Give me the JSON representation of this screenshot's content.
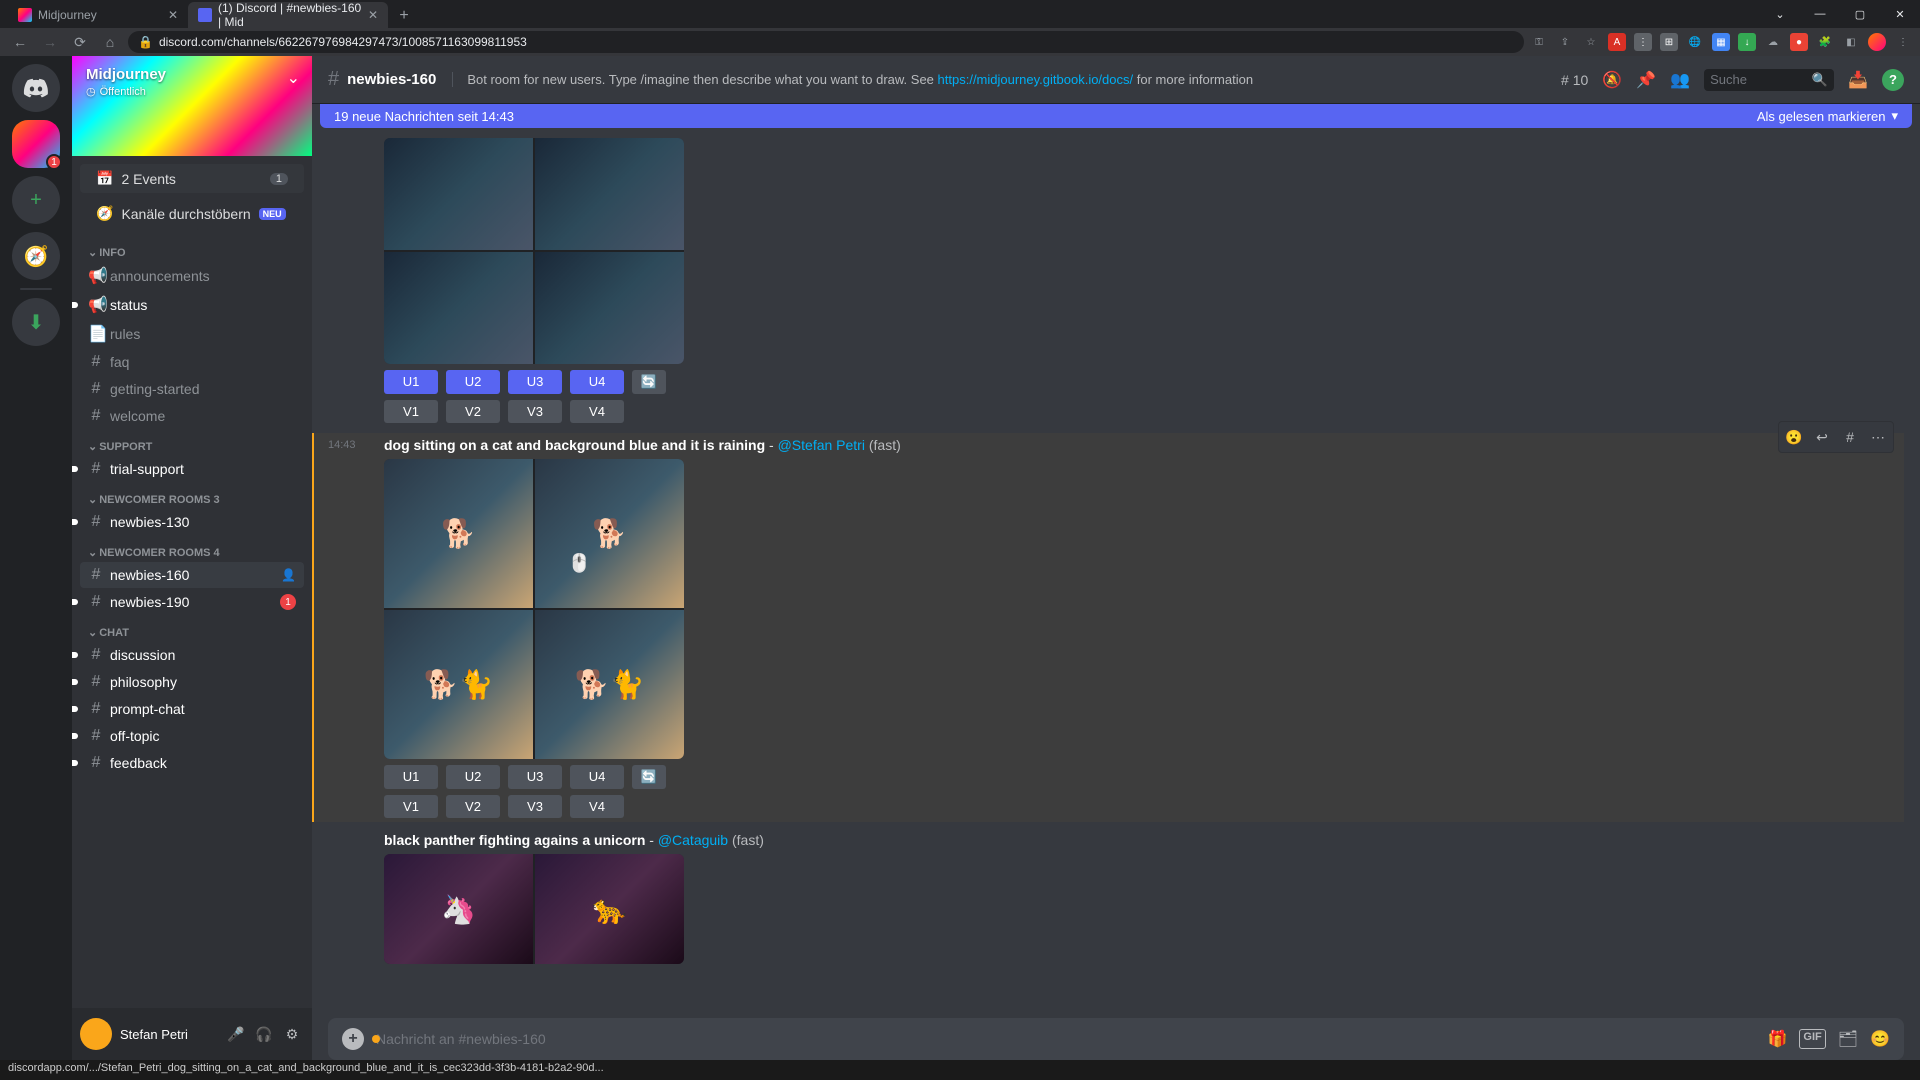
{
  "browser": {
    "tabs": [
      {
        "title": "Midjourney",
        "active": false,
        "favicon": "mj"
      },
      {
        "title": "(1) Discord | #newbies-160 | Mid",
        "active": true,
        "favicon": "dc"
      }
    ],
    "url": "discord.com/channels/662267976984297473/1008571163099811953",
    "window_controls": {
      "dropdown": "⌄",
      "min": "—",
      "max": "▢",
      "close": "✕"
    }
  },
  "server_list": {
    "home_badge": "1",
    "add": "+",
    "explore": "🧭",
    "download": "⬇"
  },
  "server_header": {
    "name": "Midjourney",
    "subtitle": "Öffentlich",
    "globe": "◷",
    "chevron": "⌄"
  },
  "sidebar": {
    "events": {
      "label": "2 Events",
      "count": "1",
      "icon": "📅"
    },
    "browse": {
      "label": "Kanäle durchstöbern",
      "badge": "NEU",
      "icon": "🧭"
    },
    "categories": [
      {
        "name": "INFO",
        "channels": [
          {
            "name": "announcements",
            "icon": "📢",
            "bold": false
          },
          {
            "name": "status",
            "icon": "📢",
            "bold": true,
            "unread": true
          },
          {
            "name": "rules",
            "icon": "📄",
            "bold": false
          },
          {
            "name": "faq",
            "icon": "#",
            "bold": false
          },
          {
            "name": "getting-started",
            "icon": "#",
            "bold": false
          },
          {
            "name": "welcome",
            "icon": "#",
            "bold": false
          }
        ]
      },
      {
        "name": "SUPPORT",
        "channels": [
          {
            "name": "trial-support",
            "icon": "#",
            "bold": true,
            "unread": true
          }
        ]
      },
      {
        "name": "NEWCOMER ROOMS 3",
        "channels": [
          {
            "name": "newbies-130",
            "icon": "#",
            "bold": true,
            "unread": true
          }
        ]
      },
      {
        "name": "NEWCOMER ROOMS 4",
        "channels": [
          {
            "name": "newbies-160",
            "icon": "#",
            "bold": true,
            "active": true,
            "person": "👤"
          },
          {
            "name": "newbies-190",
            "icon": "#",
            "bold": true,
            "unread": true,
            "badge": "1"
          }
        ]
      },
      {
        "name": "CHAT",
        "channels": [
          {
            "name": "discussion",
            "icon": "#",
            "bold": true,
            "unread": true
          },
          {
            "name": "philosophy",
            "icon": "#",
            "bold": true,
            "unread": true
          },
          {
            "name": "prompt-chat",
            "icon": "#",
            "bold": true,
            "unread": true
          },
          {
            "name": "off-topic",
            "icon": "#",
            "bold": true,
            "unread": true
          },
          {
            "name": "feedback",
            "icon": "#",
            "bold": true,
            "unread": true
          }
        ]
      }
    ]
  },
  "user_panel": {
    "name": "Stefan Petri",
    "mic": "🎤",
    "headset": "🎧",
    "gear": "⚙"
  },
  "chat_header": {
    "hash": "#",
    "title": "newbies-160",
    "topic_pre": "Bot room for new users. Type /imagine then describe what you want to draw. See ",
    "topic_link": "https://midjourney.gitbook.io/docs/",
    "topic_post": " for more information",
    "threads_icon": "#",
    "threads_count": "10",
    "icons": {
      "bell": "🔕",
      "pin": "📌",
      "people": "👥",
      "inbox": "📥"
    },
    "search_placeholder": "Suche",
    "help": "?"
  },
  "new_messages": {
    "text": "19 neue Nachrichten seit 14:43",
    "mark": "Als gelesen markieren",
    "mark_icon": "▾"
  },
  "messages": {
    "m0": {
      "u_row": [
        "U1",
        "U2",
        "U3",
        "U4"
      ],
      "v_row": [
        "V1",
        "V2",
        "V3",
        "V4"
      ],
      "refresh": "🔄"
    },
    "m1": {
      "timestamp": "14:43",
      "prompt": "dog sitting on a cat and background blue and it is raining",
      "sep": " - ",
      "author": "@Stefan Petri",
      "mode": " (fast)",
      "u_row": [
        "U1",
        "U2",
        "U3",
        "U4"
      ],
      "v_row": [
        "V1",
        "V2",
        "V3",
        "V4"
      ],
      "refresh": "🔄"
    },
    "m2": {
      "prompt": "black panther fighting agains a unicorn",
      "sep": " - ",
      "author": "@Cataguib",
      "mode": " (fast)"
    }
  },
  "msg_actions": {
    "react": "😮",
    "reply": "↩",
    "thread": "#",
    "more": "⋯"
  },
  "input": {
    "placeholder": "Nachricht an #newbies-160",
    "plus": "+",
    "gift": "🎁",
    "gif": "GIF",
    "sticker": "🗂",
    "emoji": "😊"
  },
  "status_bar": "discordapp.com/.../Stefan_Petri_dog_sitting_on_a_cat_and_background_blue_and_it_is_cec323dd-3f3b-4181-b2a2-90d..."
}
